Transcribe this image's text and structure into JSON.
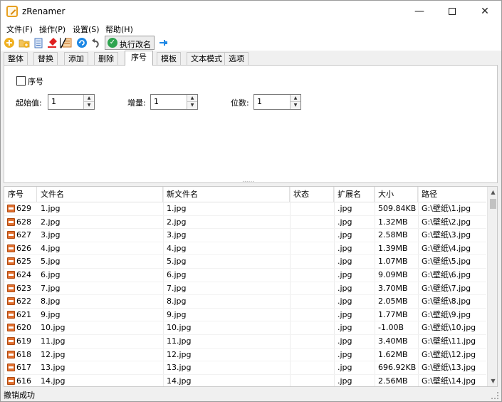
{
  "window": {
    "title": "zRenamer",
    "controls": {
      "minimize": "—",
      "close": "✕"
    }
  },
  "menu": {
    "items": [
      "文件(F)",
      "操作(P)",
      "设置(S)",
      "帮助(H)"
    ]
  },
  "toolbar": {
    "icons": [
      "add-file-icon",
      "add-folder-icon",
      "clipboard-icon",
      "clear-red-icon",
      "filter-icon",
      "refresh-icon",
      "undo-icon",
      "pin-icon"
    ],
    "run_label": "执行改名",
    "colors": {
      "add": "#f0b020",
      "red": "#e02020",
      "refresh": "#1e88e5",
      "run_check": "#2ea44f"
    }
  },
  "tabs": {
    "items": [
      "整体",
      "替换",
      "添加",
      "删除",
      "序号",
      "模板",
      "文本模式",
      "选项"
    ],
    "active_index": 4
  },
  "sequence_panel": {
    "checkbox_label": "序号",
    "start_label": "起始值:",
    "start_value": "1",
    "step_label": "增量:",
    "step_value": "1",
    "digits_label": "位数:",
    "digits_value": "1"
  },
  "table": {
    "columns": [
      "序号",
      "文件名",
      "新文件名",
      "状态",
      "扩展名",
      "大小",
      "路径"
    ],
    "rows": [
      {
        "seq": "629",
        "name": "1.jpg",
        "new_name": "1.jpg",
        "status": "",
        "ext": ".jpg",
        "size": "509.84KB",
        "path": "G:\\壁纸\\1.jpg"
      },
      {
        "seq": "628",
        "name": "2.jpg",
        "new_name": "2.jpg",
        "status": "",
        "ext": ".jpg",
        "size": "1.32MB",
        "path": "G:\\壁纸\\2.jpg"
      },
      {
        "seq": "627",
        "name": "3.jpg",
        "new_name": "3.jpg",
        "status": "",
        "ext": ".jpg",
        "size": "2.58MB",
        "path": "G:\\壁纸\\3.jpg"
      },
      {
        "seq": "626",
        "name": "4.jpg",
        "new_name": "4.jpg",
        "status": "",
        "ext": ".jpg",
        "size": "1.39MB",
        "path": "G:\\壁纸\\4.jpg"
      },
      {
        "seq": "625",
        "name": "5.jpg",
        "new_name": "5.jpg",
        "status": "",
        "ext": ".jpg",
        "size": "1.07MB",
        "path": "G:\\壁纸\\5.jpg"
      },
      {
        "seq": "624",
        "name": "6.jpg",
        "new_name": "6.jpg",
        "status": "",
        "ext": ".jpg",
        "size": "9.09MB",
        "path": "G:\\壁纸\\6.jpg"
      },
      {
        "seq": "623",
        "name": "7.jpg",
        "new_name": "7.jpg",
        "status": "",
        "ext": ".jpg",
        "size": "3.70MB",
        "path": "G:\\壁纸\\7.jpg"
      },
      {
        "seq": "622",
        "name": "8.jpg",
        "new_name": "8.jpg",
        "status": "",
        "ext": ".jpg",
        "size": "2.05MB",
        "path": "G:\\壁纸\\8.jpg"
      },
      {
        "seq": "621",
        "name": "9.jpg",
        "new_name": "9.jpg",
        "status": "",
        "ext": ".jpg",
        "size": "1.77MB",
        "path": "G:\\壁纸\\9.jpg"
      },
      {
        "seq": "620",
        "name": "10.jpg",
        "new_name": "10.jpg",
        "status": "",
        "ext": ".jpg",
        "size": "-1.00B",
        "path": "G:\\壁纸\\10.jpg"
      },
      {
        "seq": "619",
        "name": "11.jpg",
        "new_name": "11.jpg",
        "status": "",
        "ext": ".jpg",
        "size": "3.40MB",
        "path": "G:\\壁纸\\11.jpg"
      },
      {
        "seq": "618",
        "name": "12.jpg",
        "new_name": "12.jpg",
        "status": "",
        "ext": ".jpg",
        "size": "1.62MB",
        "path": "G:\\壁纸\\12.jpg"
      },
      {
        "seq": "617",
        "name": "13.jpg",
        "new_name": "13.jpg",
        "status": "",
        "ext": ".jpg",
        "size": "696.92KB",
        "path": "G:\\壁纸\\13.jpg"
      },
      {
        "seq": "616",
        "name": "14.jpg",
        "new_name": "14.jpg",
        "status": "",
        "ext": ".jpg",
        "size": "2.56MB",
        "path": "G:\\壁纸\\14.jpg"
      }
    ]
  },
  "status": {
    "text": "撤销成功"
  }
}
